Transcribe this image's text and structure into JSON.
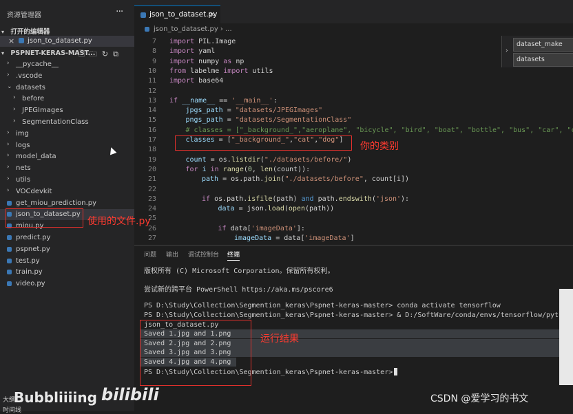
{
  "explorer": {
    "header": "资源管理器",
    "more": "···",
    "open_editors_label": "打开的编辑器",
    "open_editor_file": "json_to_dataset.py",
    "project_label": "PSPNET-KERAS-MAST...",
    "tree": [
      {
        "label": "__pycache__",
        "type": "folder",
        "depth": 0,
        "expanded": false
      },
      {
        "label": ".vscode",
        "type": "folder",
        "depth": 0,
        "expanded": false
      },
      {
        "label": "datasets",
        "type": "folder",
        "depth": 0,
        "expanded": true
      },
      {
        "label": "before",
        "type": "folder",
        "depth": 1,
        "expanded": false
      },
      {
        "label": "JPEGImages",
        "type": "folder",
        "depth": 1,
        "expanded": false
      },
      {
        "label": "SegmentationClass",
        "type": "folder",
        "depth": 1,
        "expanded": false
      },
      {
        "label": "img",
        "type": "folder",
        "depth": 0,
        "expanded": false
      },
      {
        "label": "logs",
        "type": "folder",
        "depth": 0,
        "expanded": false
      },
      {
        "label": "model_data",
        "type": "folder",
        "depth": 0,
        "expanded": false
      },
      {
        "label": "nets",
        "type": "folder",
        "depth": 0,
        "expanded": false
      },
      {
        "label": "utils",
        "type": "folder",
        "depth": 0,
        "expanded": false
      },
      {
        "label": "VOCdevkit",
        "type": "folder",
        "depth": 0,
        "expanded": false
      },
      {
        "label": "get_miou_prediction.py",
        "type": "py",
        "depth": 0
      },
      {
        "label": "json_to_dataset.py",
        "type": "py",
        "depth": 0,
        "selected": true
      },
      {
        "label": "miou.py",
        "type": "py",
        "depth": 0
      },
      {
        "label": "predict.py",
        "type": "py",
        "depth": 0
      },
      {
        "label": "pspnet.py",
        "type": "py",
        "depth": 0
      },
      {
        "label": "test.py",
        "type": "py",
        "depth": 0
      },
      {
        "label": "train.py",
        "type": "py",
        "depth": 0
      },
      {
        "label": "video.py",
        "type": "py",
        "depth": 0
      }
    ],
    "bottom_items": [
      "大纲",
      "时间线"
    ]
  },
  "annotations": {
    "used_file": "使用的文件.py",
    "your_classes": "你的类别",
    "run_result": "运行结果"
  },
  "editor": {
    "tab_name": "json_to_dataset.py",
    "breadcrumb": "json_to_dataset.py › ...",
    "suggest_fields": [
      "dataset_make",
      "datasets"
    ],
    "lines": [
      {
        "n": "7",
        "indent": 0,
        "html": "<span class=\"kw\">import</span> PIL.Image"
      },
      {
        "n": "8",
        "indent": 0,
        "html": "<span class=\"kw\">import</span> yaml"
      },
      {
        "n": "9",
        "indent": 0,
        "html": "<span class=\"kw\">import</span> numpy <span class=\"kw\">as</span> np"
      },
      {
        "n": "10",
        "indent": 0,
        "html": "<span class=\"kw\">from</span> labelme <span class=\"kw\">import</span> utils"
      },
      {
        "n": "11",
        "indent": 0,
        "html": "<span class=\"kw\">import</span> base64"
      },
      {
        "n": "12",
        "indent": 0,
        "html": ""
      },
      {
        "n": "13",
        "indent": 0,
        "html": "<span class=\"kw\">if</span> <span class=\"vr\">__name__</span> == <span class=\"st\">'__main__'</span>:"
      },
      {
        "n": "14",
        "indent": 1,
        "html": "<span class=\"vr\">jpgs_path</span> = <span class=\"st\">\"datasets/JPEGImages\"</span>"
      },
      {
        "n": "15",
        "indent": 1,
        "html": "<span class=\"vr\">pngs_path</span> = <span class=\"st\">\"datasets/SegmentationClass\"</span>"
      },
      {
        "n": "16",
        "indent": 1,
        "html": "<span class=\"cm\"># classes = [\"_background_\",\"aeroplane\", \"bicycle\", \"bird\", \"boat\", \"bottle\", \"bus\", \"car\", \"cat</span>"
      },
      {
        "n": "17",
        "indent": 1,
        "html": "<span class=\"vr\">classes</span> = [<span class=\"st\">\"_background_\"</span>,<span class=\"st\">\"cat\"</span>,<span class=\"st\">\"dog\"</span>]"
      },
      {
        "n": "18",
        "indent": 0,
        "html": ""
      },
      {
        "n": "19",
        "indent": 1,
        "html": "<span class=\"vr\">count</span> = os.<span class=\"fn\">listdir</span>(<span class=\"st\">\"./datasets/before/\"</span>)"
      },
      {
        "n": "20",
        "indent": 1,
        "html": "<span class=\"kw\">for</span> <span class=\"vr\">i</span> <span class=\"kw\">in</span> <span class=\"fn\">range</span>(<span class=\"nm\">0</span>, <span class=\"fn\">len</span>(count)):"
      },
      {
        "n": "21",
        "indent": 2,
        "html": "<span class=\"vr\">path</span> = os.path.<span class=\"fn\">join</span>(<span class=\"st\">\"./datasets/before\"</span>, count[i])"
      },
      {
        "n": "22",
        "indent": 0,
        "html": ""
      },
      {
        "n": "23",
        "indent": 2,
        "html": "<span class=\"kw\">if</span> os.path.<span class=\"fn\">isfile</span>(path) <span class=\"kw2\">and</span> path.<span class=\"fn\">endswith</span>(<span class=\"st\">'json'</span>):"
      },
      {
        "n": "24",
        "indent": 3,
        "html": "<span class=\"vr\">data</span> = json.<span class=\"fn\">load</span>(<span class=\"fn\">open</span>(path))"
      },
      {
        "n": "25",
        "indent": 0,
        "html": ""
      },
      {
        "n": "26",
        "indent": 3,
        "html": "<span class=\"kw\">if</span> data[<span class=\"st\">'imageData'</span>]:"
      },
      {
        "n": "27",
        "indent": 4,
        "html": "<span class=\"vr\">imageData</span> = data[<span class=\"st\">'imageData'</span>]"
      }
    ]
  },
  "panel": {
    "tabs": [
      "问题",
      "输出",
      "调试控制台",
      "终端"
    ],
    "active_tab": 3,
    "lines": [
      "版权所有 (C) Microsoft Corporation。保留所有权利。",
      "",
      "尝试新的跨平台 PowerShell https://aka.ms/pscore6",
      "",
      "PS D:\\Study\\Collection\\Segmention_keras\\Pspnet-keras-master> conda activate tensorflow",
      "PS D:\\Study\\Collection\\Segmention_keras\\Pspnet-keras-master> & D:/SoftWare/conda/envs/tensorflow/python.exe d",
      "json_to_dataset.py",
      "Saved 1.jpg and 1.png",
      "Saved 2.jpg and 2.png",
      "Saved 3.jpg and 3.png",
      "Saved 4.jpg and 4.png",
      "PS D:\\Study\\Collection\\Segmention_keras\\Pspnet-keras-master>"
    ]
  },
  "watermarks": {
    "uploader": "Bubbliiiing",
    "site": "bilibili",
    "csdn": "CSDN @爱学习的书文"
  }
}
